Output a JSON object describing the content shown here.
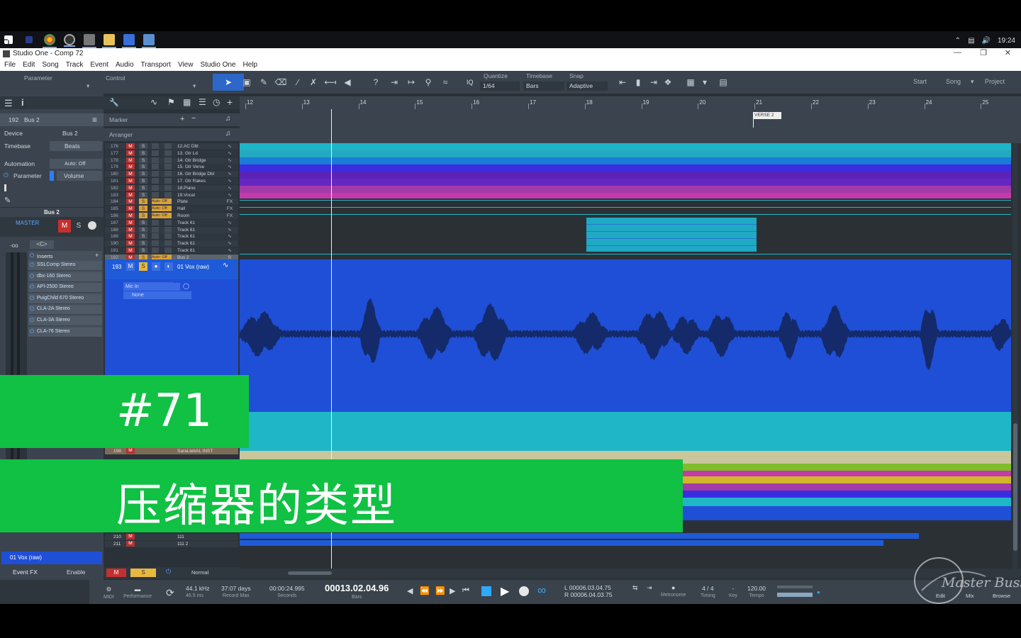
{
  "os": {
    "clock": "19:24"
  },
  "window": {
    "title": "Studio One - Comp 72"
  },
  "menu": [
    "File",
    "Edit",
    "Song",
    "Track",
    "Event",
    "Audio",
    "Transport",
    "View",
    "Studio One",
    "Help"
  ],
  "toolbar": {
    "parameter_label": "Parameter",
    "control_label": "Control",
    "quantize_label": "Quantize",
    "quantize_value": "1/64",
    "timebase_label": "Timebase",
    "timebase_value": "Bars",
    "snap_label": "Snap",
    "snap_value": "Adaptive",
    "iq_label": "IQ",
    "start": "Start",
    "song": "Song",
    "project": "Project"
  },
  "inspector": {
    "track_number": "192",
    "track_name": "Bus 2",
    "device_label": "Device",
    "device_value": "Bus 2",
    "timebase_label": "Timebase",
    "timebase_value": "Beats",
    "automation_label": "Automation",
    "automation_value": "Auto: Off",
    "parameter_label": "Parameter",
    "parameter_value": "Volume",
    "channel_name": "Bus 2",
    "master_label": "MASTER",
    "mute": "M",
    "solo": "S",
    "volume_readout": "-oo",
    "pan_readout": "<C>",
    "inserts_label": "Inserts",
    "inserts": [
      "SSLComp Stereo",
      "dbx-160 Stereo",
      "API-2500 Stereo",
      "PuigChild 670 Stereo",
      "CLA-2A Stereo",
      "CLA-3A Stereo",
      "CLA-76 Stereo"
    ],
    "bottom_track": "01 Vox (raw)",
    "event_fx": "Event FX",
    "enable": "Enable"
  },
  "tracklist": {
    "marker_label": "Marker",
    "arranger_label": "Arranger",
    "tracks": [
      {
        "num": "176",
        "name": "12.AC Dbl",
        "type": "∿"
      },
      {
        "num": "177",
        "name": "13. Gtr Ld",
        "type": "∿"
      },
      {
        "num": "178",
        "name": "14. Gtr Bridge",
        "type": "∿"
      },
      {
        "num": "179",
        "name": "15. Gtr Verse",
        "type": "∿"
      },
      {
        "num": "180",
        "name": "16. Gtr Bridge Dbl",
        "type": "∿"
      },
      {
        "num": "181",
        "name": "17. Gtr Rakes",
        "type": "∿"
      },
      {
        "num": "182",
        "name": "18.Piano",
        "type": "∿"
      },
      {
        "num": "183",
        "name": "19.Vocal",
        "type": "∿"
      },
      {
        "num": "184",
        "name": "Plate",
        "type": "FX"
      },
      {
        "num": "185",
        "name": "Hall",
        "type": "FX"
      },
      {
        "num": "186",
        "name": "Room",
        "type": "FX"
      },
      {
        "num": "187",
        "name": "Track 61",
        "type": "∿"
      },
      {
        "num": "188",
        "name": "Track 61",
        "type": "∿"
      },
      {
        "num": "189",
        "name": "Track 61",
        "type": "∿"
      },
      {
        "num": "190",
        "name": "Track 61",
        "type": "∿"
      },
      {
        "num": "191",
        "name": "Track 61",
        "type": "∿"
      },
      {
        "num": "192",
        "name": "Bus 2",
        "type": "B"
      }
    ],
    "auto_off": "Auto: Off",
    "selected_track": {
      "num": "193",
      "name": "01 Vox (raw)",
      "input": "Mic In",
      "output": "None"
    },
    "lower_tracks": [
      {
        "num": "198",
        "name": "SaraLiebAL INST"
      },
      {
        "num": "210",
        "name": "111"
      },
      {
        "num": "211",
        "name": "111 2"
      }
    ],
    "mode": "Normal"
  },
  "ruler": {
    "bars": [
      "12",
      "13",
      "14",
      "15",
      "16",
      "17",
      "18",
      "19",
      "20",
      "21",
      "22",
      "23",
      "24",
      "25"
    ],
    "marker": "VERSE 2"
  },
  "transport": {
    "midi": "MIDI",
    "performance": "Performance",
    "sample_rate": "44.1 kHz",
    "latency": "46.5 ms",
    "record_max": "37:07 days",
    "record_max_label": "Record Max",
    "seconds": "00:00:24.995",
    "seconds_label": "Seconds",
    "bars": "00013.02.04.96",
    "bars_label": "Bars",
    "loop_l": "00006.03.04.75",
    "loop_r": "00006.04.03.75",
    "l_label": "L",
    "r_label": "R",
    "metronome": "Metronome",
    "timing": "4 / 4",
    "timing_label": "Timing",
    "key": "-",
    "key_label": "Key",
    "tempo": "120.00",
    "tempo_label": "Tempo",
    "edit": "Edit",
    "mix": "Mix",
    "browse": "Browse"
  },
  "overlay": {
    "episode": "#71",
    "title": "压缩器的类型",
    "watermark": "Master Buss"
  },
  "colors": {
    "banner_green": "#10c143",
    "vocal_blue": "#1f4fd6",
    "teal": "#1fb6c8",
    "magenta": "#c43aa8",
    "purple": "#5b22b8"
  }
}
